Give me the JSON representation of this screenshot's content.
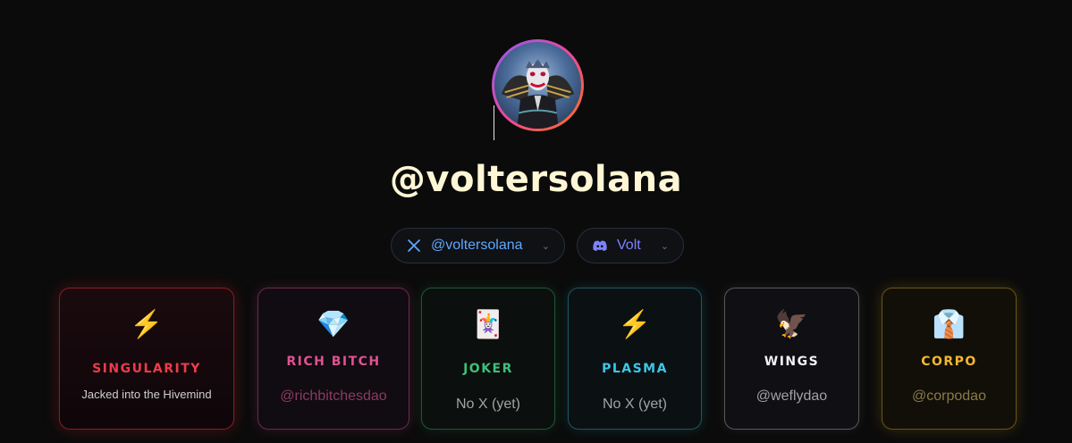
{
  "profile": {
    "username": "@voltersolana",
    "avatar_icon": "joker-avatar-icon"
  },
  "socials": {
    "x": {
      "handle": "@voltersolana",
      "icon": "x-logo-icon",
      "color": "#5fa8ff"
    },
    "discord": {
      "handle": "Volt",
      "icon": "discord-logo-icon",
      "color": "#7c83ff"
    }
  },
  "cards": [
    {
      "id": "singularity",
      "emoji": "⚡",
      "name": "SINGULARITY",
      "subtitle": "Jacked into the Hivemind",
      "name_color": "#ef3b4c",
      "sub_color": "#cfcfcf"
    },
    {
      "id": "rich-bitch",
      "emoji": "💎",
      "name": "RICH BITCH",
      "subtitle": "@richbitchesdao",
      "name_color": "#e0528f",
      "sub_color": "#8a3c60"
    },
    {
      "id": "joker",
      "emoji": "🃏",
      "name": "JOKER",
      "subtitle": "No X (yet)",
      "name_color": "#3fbf78",
      "sub_color": "#a3a3a3"
    },
    {
      "id": "plasma",
      "emoji": "⚡",
      "name": "PLASMA",
      "subtitle": "No X (yet)",
      "name_color": "#3ec7e6",
      "sub_color": "#a3a3a3"
    },
    {
      "id": "wings",
      "emoji": "🦅",
      "name": "WINGS",
      "subtitle": "@weflydao",
      "name_color": "#f2f2f2",
      "sub_color": "#a3a3a3"
    },
    {
      "id": "corpo",
      "emoji": "👔",
      "name": "CORPO",
      "subtitle": "@corpodao",
      "name_color": "#f5b731",
      "sub_color": "#8a7a4a"
    }
  ]
}
